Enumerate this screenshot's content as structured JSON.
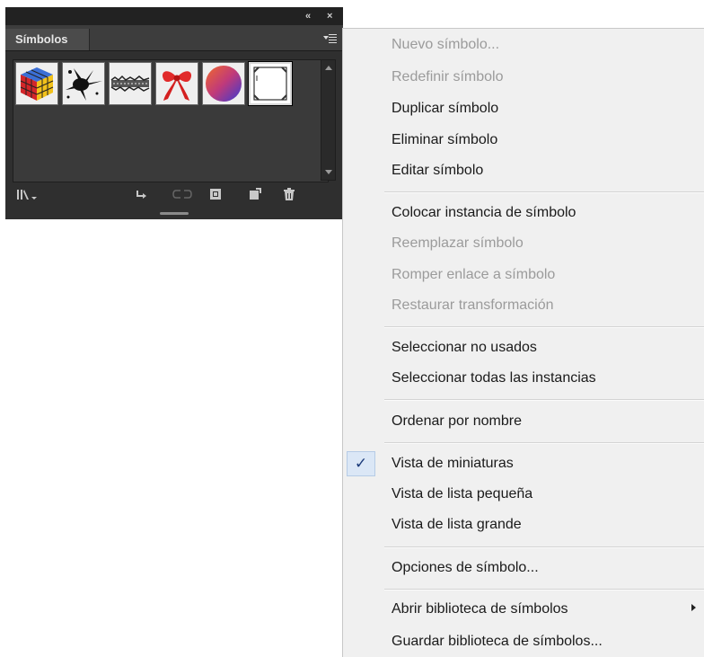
{
  "panel": {
    "tab_label": "Símbolos",
    "collapse_glyph": "«",
    "close_glyph": "×",
    "symbols": [
      {
        "name": "rubik-cube"
      },
      {
        "name": "ink-splat"
      },
      {
        "name": "grunge-stroke"
      },
      {
        "name": "red-bow"
      },
      {
        "name": "gradient-sphere"
      },
      {
        "name": "blank-frame",
        "selected": true
      }
    ],
    "footer_icons": [
      "library-menu-icon",
      "place-instance-icon",
      "break-link-icon",
      "symbol-options-icon",
      "new-symbol-icon",
      "delete-icon"
    ]
  },
  "menu": {
    "items": [
      {
        "label": "Nuevo símbolo...",
        "enabled": false
      },
      {
        "label": "Redefinir símbolo",
        "enabled": false
      },
      {
        "label": "Duplicar símbolo",
        "enabled": true
      },
      {
        "label": "Eliminar símbolo",
        "enabled": true
      },
      {
        "label": "Editar símbolo",
        "enabled": true
      },
      {
        "label": "Colocar instancia de símbolo",
        "enabled": true
      },
      {
        "label": "Reemplazar símbolo",
        "enabled": false
      },
      {
        "label": "Romper enlace a símbolo",
        "enabled": false
      },
      {
        "label": "Restaurar transformación",
        "enabled": false
      },
      {
        "label": "Seleccionar no usados",
        "enabled": true
      },
      {
        "label": "Seleccionar todas las instancias",
        "enabled": true
      },
      {
        "label": "Ordenar por nombre",
        "enabled": true
      },
      {
        "label": "Vista de miniaturas",
        "enabled": true,
        "checked": true
      },
      {
        "label": "Vista de lista pequeña",
        "enabled": true
      },
      {
        "label": "Vista de lista grande",
        "enabled": true
      },
      {
        "label": "Opciones de símbolo...",
        "enabled": true
      },
      {
        "label": "Abrir biblioteca de símbolos",
        "enabled": true,
        "submenu": true
      },
      {
        "label": "Guardar biblioteca de símbolos...",
        "enabled": true
      }
    ],
    "check_glyph": "✓",
    "colors": {
      "enabled_text": "#1a1a1a",
      "disabled_text": "#9b9b9b",
      "check_highlight": "#dbe7f6"
    }
  }
}
